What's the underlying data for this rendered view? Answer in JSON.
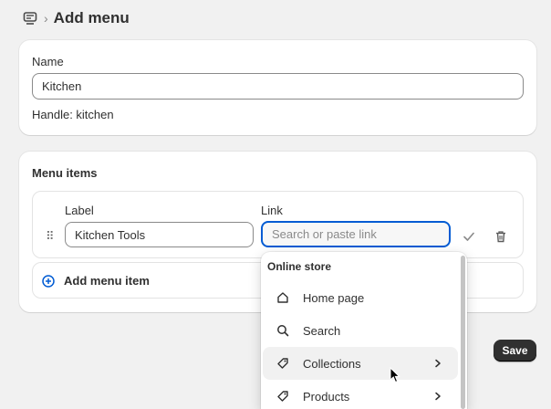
{
  "header": {
    "title": "Add menu",
    "separator": "›"
  },
  "name_card": {
    "label": "Name",
    "value": "Kitchen",
    "handle": "Handle: kitchen"
  },
  "menu_card": {
    "title": "Menu items",
    "label_header": "Label",
    "link_header": "Link",
    "item_label_value": "Kitchen Tools",
    "link_placeholder": "Search or paste link",
    "add_item": "Add menu item"
  },
  "dropdown": {
    "heading": "Online store",
    "items": [
      {
        "label": "Home page",
        "icon": "home-icon",
        "has_submenu": false
      },
      {
        "label": "Search",
        "icon": "search-icon",
        "has_submenu": false
      },
      {
        "label": "Collections",
        "icon": "tag-icon",
        "has_submenu": true
      },
      {
        "label": "Products",
        "icon": "tag-icon",
        "has_submenu": true
      }
    ]
  },
  "save_label": "Save",
  "colors": {
    "primary_button": "#303030",
    "focus": "#005bd3",
    "background": "#f1f1f1"
  }
}
